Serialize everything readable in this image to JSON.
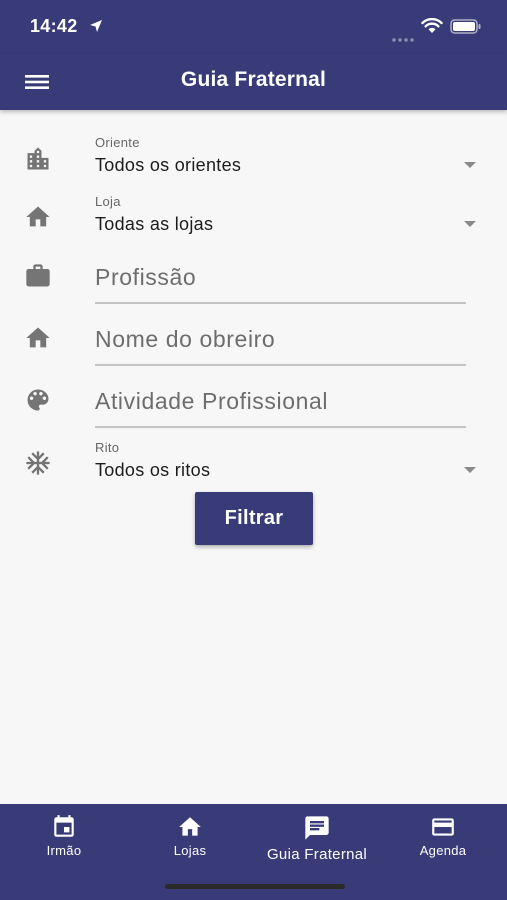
{
  "status_bar": {
    "time": "14:42"
  },
  "app_bar": {
    "title": "Guia Fraternal"
  },
  "form": {
    "oriente": {
      "label": "Oriente",
      "value": "Todos os orientes"
    },
    "loja": {
      "label": "Loja",
      "value": "Todas as lojas"
    },
    "profissao": {
      "placeholder": "Profissão"
    },
    "nome_obreiro": {
      "placeholder": "Nome do obreiro"
    },
    "atividade": {
      "placeholder": "Atividade Profissional"
    },
    "rito": {
      "label": "Rito",
      "value": "Todos os ritos"
    }
  },
  "filter_button": {
    "label": "Filtrar"
  },
  "bottom_nav": {
    "items": [
      {
        "label": "Irmão",
        "icon": "calendar-icon"
      },
      {
        "label": "Lojas",
        "icon": "home-icon"
      },
      {
        "label": "Guia Fraternal",
        "icon": "message-icon",
        "active": true
      },
      {
        "label": "Agenda",
        "icon": "card-icon"
      }
    ]
  },
  "colors": {
    "primary": "#383b78",
    "background": "#f7f7f7",
    "icon_gray": "#757575"
  }
}
